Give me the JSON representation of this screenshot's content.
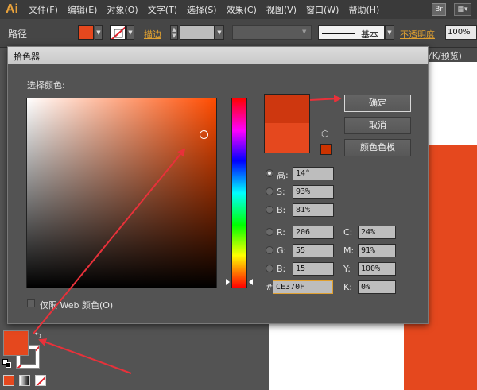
{
  "app": {
    "logo": "Ai",
    "menu": [
      "文件(F)",
      "编辑(E)",
      "对象(O)",
      "文字(T)",
      "选择(S)",
      "效果(C)",
      "视图(V)",
      "窗口(W)",
      "帮助(H)"
    ],
    "bridge_badge": "Br"
  },
  "controlbar": {
    "selection_label": "路径",
    "fill_color": "#e5481e",
    "stroke_label": "描边",
    "brush_label": "基本",
    "opacity_label": "不透明度",
    "opacity_value": "100%"
  },
  "document": {
    "tab_label": "YK/预览)"
  },
  "dialog": {
    "title": "拾色器",
    "select_label": "选择颜色:",
    "buttons": {
      "ok": "确定",
      "cancel": "取消",
      "swatches": "颜色色板"
    },
    "hsb": {
      "h_label": "高:",
      "h_value": "14°",
      "s_label": "S:",
      "s_value": "93%",
      "b_label": "B:",
      "b_value": "81%"
    },
    "rgb": {
      "r_label": "R:",
      "r_value": "206",
      "g_label": "G:",
      "g_value": "55",
      "b_label": "B:",
      "b_value": "15"
    },
    "cmyk": {
      "c_label": "C:",
      "c_value": "24%",
      "m_label": "M:",
      "m_value": "91%",
      "y_label": "Y:",
      "y_value": "100%",
      "k_label": "K:",
      "k_value": "0%"
    },
    "hex_label": "#",
    "hex_value": "CE370F",
    "web_only_label": "仅限 Web 颜色(O)",
    "new_color": "#ce370f",
    "current_color": "#e5481e",
    "selected_hue": "h"
  },
  "colors": {
    "annotation_arrow": "#e8313a"
  }
}
